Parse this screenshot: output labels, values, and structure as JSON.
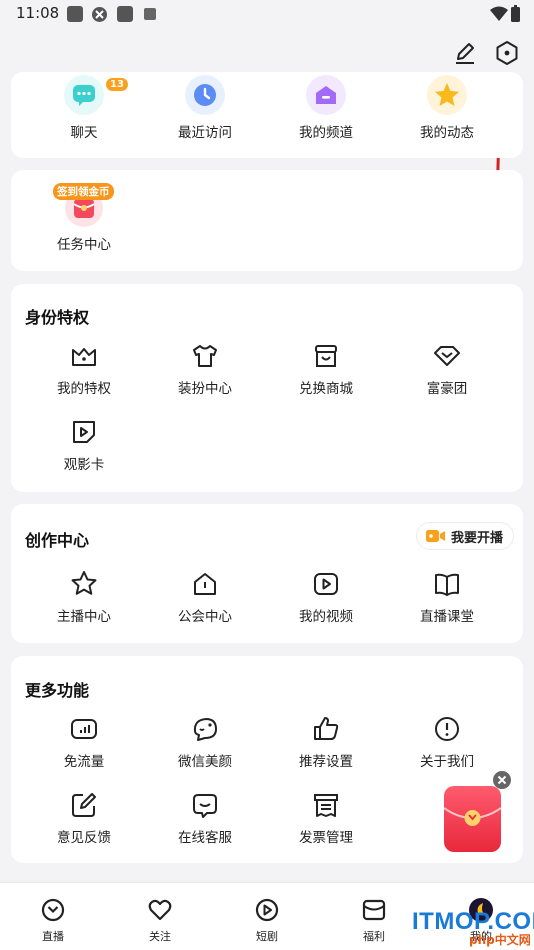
{
  "status": {
    "time": "11:08"
  },
  "top_shortcuts": [
    {
      "label": "聊天",
      "badge": "13",
      "icon": "chat-icon",
      "color": "#3ccfcf"
    },
    {
      "label": "最近访问",
      "icon": "clock-icon",
      "color": "#5b8bf5"
    },
    {
      "label": "我的频道",
      "icon": "channel-icon",
      "color": "#a36bf5"
    },
    {
      "label": "我的动态",
      "icon": "star-icon",
      "color": "#f9b81b"
    }
  ],
  "task": {
    "badge": "签到领金币",
    "label": "任务中心",
    "icon": "red-envelope-icon"
  },
  "identity": {
    "title": "身份特权",
    "items": [
      {
        "label": "我的特权",
        "icon": "crown-icon"
      },
      {
        "label": "装扮中心",
        "icon": "shirt-icon"
      },
      {
        "label": "兑换商城",
        "icon": "shop-icon"
      },
      {
        "label": "富豪团",
        "icon": "diamond-icon"
      },
      {
        "label": "观影卡",
        "icon": "film-card-icon"
      }
    ]
  },
  "creation": {
    "title": "创作中心",
    "live_button": "我要开播",
    "items": [
      {
        "label": "主播中心",
        "icon": "star-outline-icon"
      },
      {
        "label": "公会中心",
        "icon": "house-icon"
      },
      {
        "label": "我的视频",
        "icon": "video-icon"
      },
      {
        "label": "直播课堂",
        "icon": "book-icon"
      }
    ]
  },
  "more": {
    "title": "更多功能",
    "items": [
      {
        "label": "免流量",
        "icon": "data-icon"
      },
      {
        "label": "微信美颜",
        "icon": "beauty-icon"
      },
      {
        "label": "推荐设置",
        "icon": "thumbs-up-icon"
      },
      {
        "label": "关于我们",
        "icon": "info-icon"
      },
      {
        "label": "意见反馈",
        "icon": "edit-icon"
      },
      {
        "label": "在线客服",
        "icon": "service-icon"
      },
      {
        "label": "发票管理",
        "icon": "invoice-icon"
      }
    ]
  },
  "tabs": [
    {
      "label": "直播",
      "icon": "live-tab-icon"
    },
    {
      "label": "关注",
      "icon": "heart-tab-icon"
    },
    {
      "label": "短剧",
      "icon": "play-tab-icon"
    },
    {
      "label": "福利",
      "icon": "gift-tab-icon"
    },
    {
      "label": "我的",
      "icon": "profile-tab-icon"
    }
  ],
  "watermark": "ITMOP.COM",
  "watermark2": "php中文网"
}
